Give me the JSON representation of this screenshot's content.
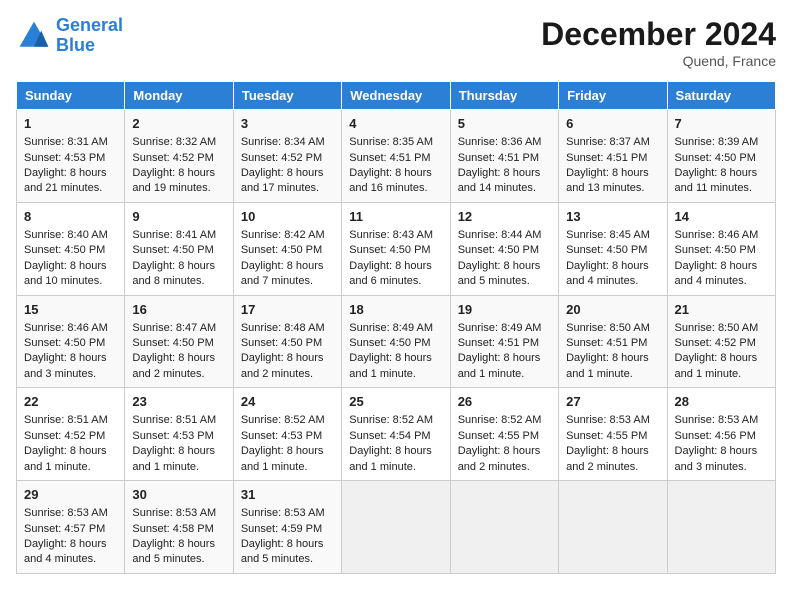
{
  "header": {
    "logo_line1": "General",
    "logo_line2": "Blue",
    "month": "December 2024",
    "location": "Quend, France"
  },
  "weekdays": [
    "Sunday",
    "Monday",
    "Tuesday",
    "Wednesday",
    "Thursday",
    "Friday",
    "Saturday"
  ],
  "weeks": [
    [
      {
        "day": "1",
        "info": "Sunrise: 8:31 AM\nSunset: 4:53 PM\nDaylight: 8 hours and 21 minutes."
      },
      {
        "day": "2",
        "info": "Sunrise: 8:32 AM\nSunset: 4:52 PM\nDaylight: 8 hours and 19 minutes."
      },
      {
        "day": "3",
        "info": "Sunrise: 8:34 AM\nSunset: 4:52 PM\nDaylight: 8 hours and 17 minutes."
      },
      {
        "day": "4",
        "info": "Sunrise: 8:35 AM\nSunset: 4:51 PM\nDaylight: 8 hours and 16 minutes."
      },
      {
        "day": "5",
        "info": "Sunrise: 8:36 AM\nSunset: 4:51 PM\nDaylight: 8 hours and 14 minutes."
      },
      {
        "day": "6",
        "info": "Sunrise: 8:37 AM\nSunset: 4:51 PM\nDaylight: 8 hours and 13 minutes."
      },
      {
        "day": "7",
        "info": "Sunrise: 8:39 AM\nSunset: 4:50 PM\nDaylight: 8 hours and 11 minutes."
      }
    ],
    [
      {
        "day": "8",
        "info": "Sunrise: 8:40 AM\nSunset: 4:50 PM\nDaylight: 8 hours and 10 minutes."
      },
      {
        "day": "9",
        "info": "Sunrise: 8:41 AM\nSunset: 4:50 PM\nDaylight: 8 hours and 8 minutes."
      },
      {
        "day": "10",
        "info": "Sunrise: 8:42 AM\nSunset: 4:50 PM\nDaylight: 8 hours and 7 minutes."
      },
      {
        "day": "11",
        "info": "Sunrise: 8:43 AM\nSunset: 4:50 PM\nDaylight: 8 hours and 6 minutes."
      },
      {
        "day": "12",
        "info": "Sunrise: 8:44 AM\nSunset: 4:50 PM\nDaylight: 8 hours and 5 minutes."
      },
      {
        "day": "13",
        "info": "Sunrise: 8:45 AM\nSunset: 4:50 PM\nDaylight: 8 hours and 4 minutes."
      },
      {
        "day": "14",
        "info": "Sunrise: 8:46 AM\nSunset: 4:50 PM\nDaylight: 8 hours and 4 minutes."
      }
    ],
    [
      {
        "day": "15",
        "info": "Sunrise: 8:46 AM\nSunset: 4:50 PM\nDaylight: 8 hours and 3 minutes."
      },
      {
        "day": "16",
        "info": "Sunrise: 8:47 AM\nSunset: 4:50 PM\nDaylight: 8 hours and 2 minutes."
      },
      {
        "day": "17",
        "info": "Sunrise: 8:48 AM\nSunset: 4:50 PM\nDaylight: 8 hours and 2 minutes."
      },
      {
        "day": "18",
        "info": "Sunrise: 8:49 AM\nSunset: 4:50 PM\nDaylight: 8 hours and 1 minute."
      },
      {
        "day": "19",
        "info": "Sunrise: 8:49 AM\nSunset: 4:51 PM\nDaylight: 8 hours and 1 minute."
      },
      {
        "day": "20",
        "info": "Sunrise: 8:50 AM\nSunset: 4:51 PM\nDaylight: 8 hours and 1 minute."
      },
      {
        "day": "21",
        "info": "Sunrise: 8:50 AM\nSunset: 4:52 PM\nDaylight: 8 hours and 1 minute."
      }
    ],
    [
      {
        "day": "22",
        "info": "Sunrise: 8:51 AM\nSunset: 4:52 PM\nDaylight: 8 hours and 1 minute."
      },
      {
        "day": "23",
        "info": "Sunrise: 8:51 AM\nSunset: 4:53 PM\nDaylight: 8 hours and 1 minute."
      },
      {
        "day": "24",
        "info": "Sunrise: 8:52 AM\nSunset: 4:53 PM\nDaylight: 8 hours and 1 minute."
      },
      {
        "day": "25",
        "info": "Sunrise: 8:52 AM\nSunset: 4:54 PM\nDaylight: 8 hours and 1 minute."
      },
      {
        "day": "26",
        "info": "Sunrise: 8:52 AM\nSunset: 4:55 PM\nDaylight: 8 hours and 2 minutes."
      },
      {
        "day": "27",
        "info": "Sunrise: 8:53 AM\nSunset: 4:55 PM\nDaylight: 8 hours and 2 minutes."
      },
      {
        "day": "28",
        "info": "Sunrise: 8:53 AM\nSunset: 4:56 PM\nDaylight: 8 hours and 3 minutes."
      }
    ],
    [
      {
        "day": "29",
        "info": "Sunrise: 8:53 AM\nSunset: 4:57 PM\nDaylight: 8 hours and 4 minutes."
      },
      {
        "day": "30",
        "info": "Sunrise: 8:53 AM\nSunset: 4:58 PM\nDaylight: 8 hours and 5 minutes."
      },
      {
        "day": "31",
        "info": "Sunrise: 8:53 AM\nSunset: 4:59 PM\nDaylight: 8 hours and 5 minutes."
      },
      null,
      null,
      null,
      null
    ]
  ]
}
